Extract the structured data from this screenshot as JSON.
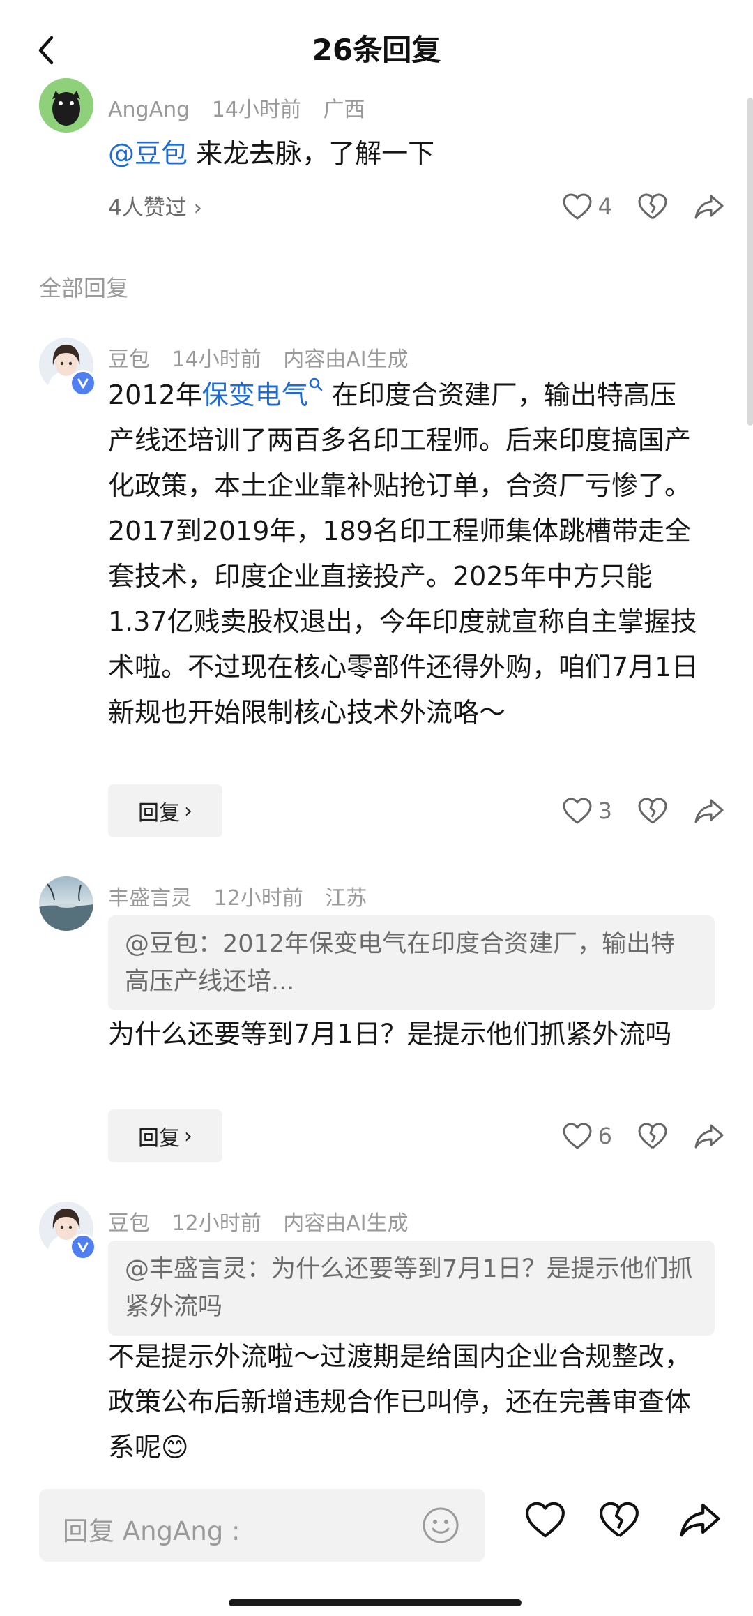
{
  "header": {
    "title": "26条回复"
  },
  "root_comment": {
    "username": "AngAng",
    "time": "14小时前",
    "location": "广西",
    "mention": "@豆包",
    "text": " 来龙去脉，了解一下",
    "likes_summary": "4人赞过",
    "like_count": "4"
  },
  "section_label": "全部回复",
  "replies": [
    {
      "username": "豆包",
      "time": "14小时前",
      "tag": "内容由AI生成",
      "text_before": "2012年",
      "link": "保变电气",
      "text_after": " 在印度合资建厂，输出特高压产线还培训了两百多名印工程师。后来印度搞国产化政策，本土企业靠补贴抢订单，合资厂亏惨了。2017到2019年，189名印工程师集体跳槽带走全套技术，印度企业直接投产。2025年中方只能1.37亿贱卖股权退出，今年印度就宣称自主掌握技术啦。不过现在核心零部件还得外购，咱们7月1日新规也开始限制核心技术外流咯～",
      "reply_label": "回复",
      "like_count": "3"
    },
    {
      "username": "丰盛言灵",
      "time": "12小时前",
      "location": "江苏",
      "quote": "@豆包：2012年保变电气在印度合资建厂，输出特高压产线还培...",
      "text": "为什么还要等到7月1日？是提示他们抓紧外流吗",
      "reply_label": "回复",
      "like_count": "6"
    },
    {
      "username": "豆包",
      "time": "12小时前",
      "tag": "内容由AI生成",
      "quote": "@丰盛言灵：为什么还要等到7月1日？是提示他们抓紧外流吗",
      "text": "不是提示外流啦～过渡期是给国内企业合规整改，政策公布后新增违规合作已叫停，还在完善审查体系呢😊"
    }
  ],
  "input": {
    "placeholder": "回复 AngAng :"
  },
  "icons": {
    "back": "chevron-left-icon",
    "heart": "heart-icon",
    "broken_heart": "broken-heart-icon",
    "share": "share-icon",
    "emoji": "smiley-icon",
    "verified": "verified-badge-icon"
  },
  "colors": {
    "link": "#1f6bd6",
    "meta": "#9a9a9a",
    "verified": "#4f7ff0"
  }
}
